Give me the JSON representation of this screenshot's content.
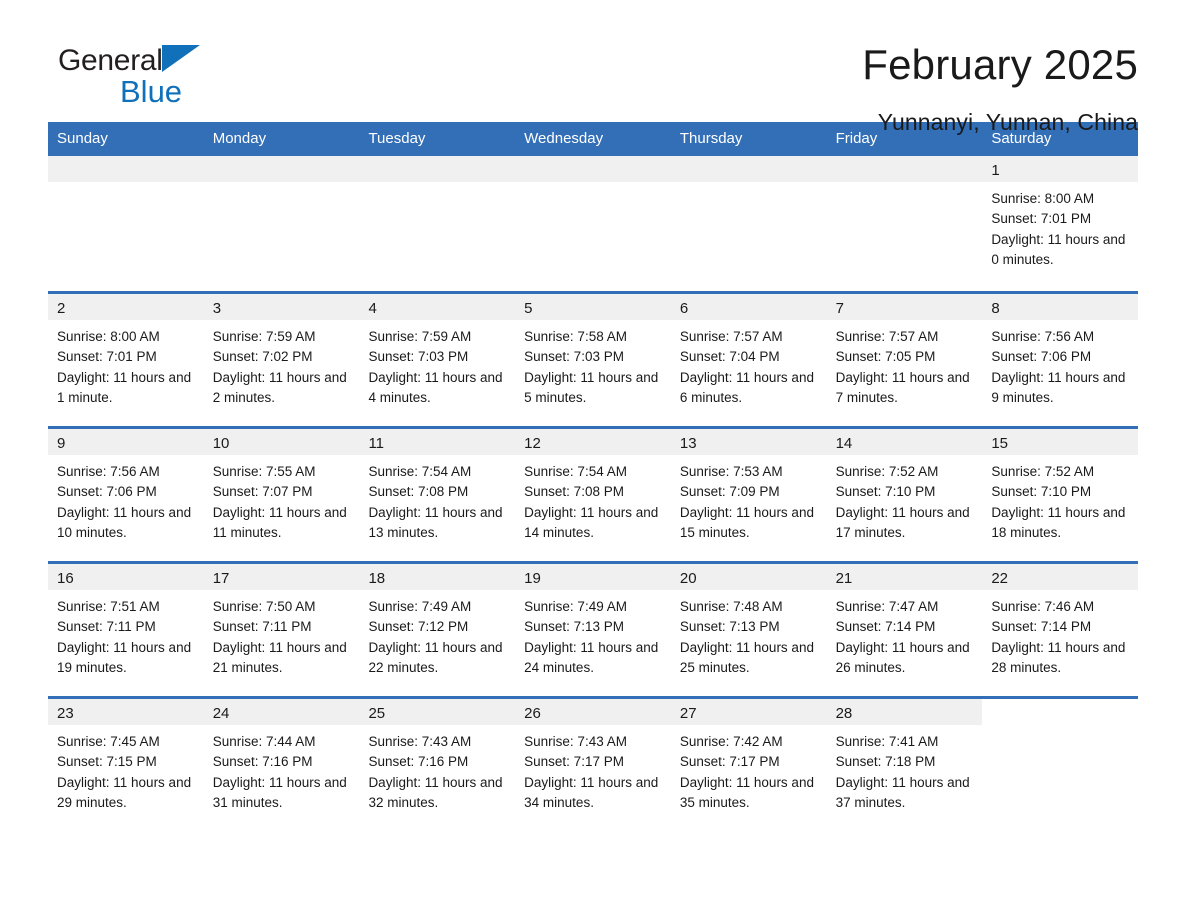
{
  "brand": {
    "name_part1": "General",
    "name_part2": "Blue",
    "logo_icon": "triangle-icon",
    "accent_color": "#1070ba"
  },
  "header": {
    "title": "February 2025",
    "subtitle": "Yunnanyi, Yunnan, China"
  },
  "calendar": {
    "header_background": "#336fb7",
    "daynum_background": "#f0f0f0",
    "weekdays": [
      "Sunday",
      "Monday",
      "Tuesday",
      "Wednesday",
      "Thursday",
      "Friday",
      "Saturday"
    ],
    "weeks": [
      [
        {
          "day": "",
          "empty": true
        },
        {
          "day": "",
          "empty": true
        },
        {
          "day": "",
          "empty": true
        },
        {
          "day": "",
          "empty": true
        },
        {
          "day": "",
          "empty": true
        },
        {
          "day": "",
          "empty": true
        },
        {
          "day": "1",
          "sunrise": "Sunrise: 8:00 AM",
          "sunset": "Sunset: 7:01 PM",
          "daylight": "Daylight: 11 hours and 0 minutes."
        }
      ],
      [
        {
          "day": "2",
          "sunrise": "Sunrise: 8:00 AM",
          "sunset": "Sunset: 7:01 PM",
          "daylight": "Daylight: 11 hours and 1 minute."
        },
        {
          "day": "3",
          "sunrise": "Sunrise: 7:59 AM",
          "sunset": "Sunset: 7:02 PM",
          "daylight": "Daylight: 11 hours and 2 minutes."
        },
        {
          "day": "4",
          "sunrise": "Sunrise: 7:59 AM",
          "sunset": "Sunset: 7:03 PM",
          "daylight": "Daylight: 11 hours and 4 minutes."
        },
        {
          "day": "5",
          "sunrise": "Sunrise: 7:58 AM",
          "sunset": "Sunset: 7:03 PM",
          "daylight": "Daylight: 11 hours and 5 minutes."
        },
        {
          "day": "6",
          "sunrise": "Sunrise: 7:57 AM",
          "sunset": "Sunset: 7:04 PM",
          "daylight": "Daylight: 11 hours and 6 minutes."
        },
        {
          "day": "7",
          "sunrise": "Sunrise: 7:57 AM",
          "sunset": "Sunset: 7:05 PM",
          "daylight": "Daylight: 11 hours and 7 minutes."
        },
        {
          "day": "8",
          "sunrise": "Sunrise: 7:56 AM",
          "sunset": "Sunset: 7:06 PM",
          "daylight": "Daylight: 11 hours and 9 minutes."
        }
      ],
      [
        {
          "day": "9",
          "sunrise": "Sunrise: 7:56 AM",
          "sunset": "Sunset: 7:06 PM",
          "daylight": "Daylight: 11 hours and 10 minutes."
        },
        {
          "day": "10",
          "sunrise": "Sunrise: 7:55 AM",
          "sunset": "Sunset: 7:07 PM",
          "daylight": "Daylight: 11 hours and 11 minutes."
        },
        {
          "day": "11",
          "sunrise": "Sunrise: 7:54 AM",
          "sunset": "Sunset: 7:08 PM",
          "daylight": "Daylight: 11 hours and 13 minutes."
        },
        {
          "day": "12",
          "sunrise": "Sunrise: 7:54 AM",
          "sunset": "Sunset: 7:08 PM",
          "daylight": "Daylight: 11 hours and 14 minutes."
        },
        {
          "day": "13",
          "sunrise": "Sunrise: 7:53 AM",
          "sunset": "Sunset: 7:09 PM",
          "daylight": "Daylight: 11 hours and 15 minutes."
        },
        {
          "day": "14",
          "sunrise": "Sunrise: 7:52 AM",
          "sunset": "Sunset: 7:10 PM",
          "daylight": "Daylight: 11 hours and 17 minutes."
        },
        {
          "day": "15",
          "sunrise": "Sunrise: 7:52 AM",
          "sunset": "Sunset: 7:10 PM",
          "daylight": "Daylight: 11 hours and 18 minutes."
        }
      ],
      [
        {
          "day": "16",
          "sunrise": "Sunrise: 7:51 AM",
          "sunset": "Sunset: 7:11 PM",
          "daylight": "Daylight: 11 hours and 19 minutes."
        },
        {
          "day": "17",
          "sunrise": "Sunrise: 7:50 AM",
          "sunset": "Sunset: 7:11 PM",
          "daylight": "Daylight: 11 hours and 21 minutes."
        },
        {
          "day": "18",
          "sunrise": "Sunrise: 7:49 AM",
          "sunset": "Sunset: 7:12 PM",
          "daylight": "Daylight: 11 hours and 22 minutes."
        },
        {
          "day": "19",
          "sunrise": "Sunrise: 7:49 AM",
          "sunset": "Sunset: 7:13 PM",
          "daylight": "Daylight: 11 hours and 24 minutes."
        },
        {
          "day": "20",
          "sunrise": "Sunrise: 7:48 AM",
          "sunset": "Sunset: 7:13 PM",
          "daylight": "Daylight: 11 hours and 25 minutes."
        },
        {
          "day": "21",
          "sunrise": "Sunrise: 7:47 AM",
          "sunset": "Sunset: 7:14 PM",
          "daylight": "Daylight: 11 hours and 26 minutes."
        },
        {
          "day": "22",
          "sunrise": "Sunrise: 7:46 AM",
          "sunset": "Sunset: 7:14 PM",
          "daylight": "Daylight: 11 hours and 28 minutes."
        }
      ],
      [
        {
          "day": "23",
          "sunrise": "Sunrise: 7:45 AM",
          "sunset": "Sunset: 7:15 PM",
          "daylight": "Daylight: 11 hours and 29 minutes."
        },
        {
          "day": "24",
          "sunrise": "Sunrise: 7:44 AM",
          "sunset": "Sunset: 7:16 PM",
          "daylight": "Daylight: 11 hours and 31 minutes."
        },
        {
          "day": "25",
          "sunrise": "Sunrise: 7:43 AM",
          "sunset": "Sunset: 7:16 PM",
          "daylight": "Daylight: 11 hours and 32 minutes."
        },
        {
          "day": "26",
          "sunrise": "Sunrise: 7:43 AM",
          "sunset": "Sunset: 7:17 PM",
          "daylight": "Daylight: 11 hours and 34 minutes."
        },
        {
          "day": "27",
          "sunrise": "Sunrise: 7:42 AM",
          "sunset": "Sunset: 7:17 PM",
          "daylight": "Daylight: 11 hours and 35 minutes."
        },
        {
          "day": "28",
          "sunrise": "Sunrise: 7:41 AM",
          "sunset": "Sunset: 7:18 PM",
          "daylight": "Daylight: 11 hours and 37 minutes."
        },
        {
          "day": "",
          "empty": true,
          "no_band": true
        }
      ]
    ]
  }
}
